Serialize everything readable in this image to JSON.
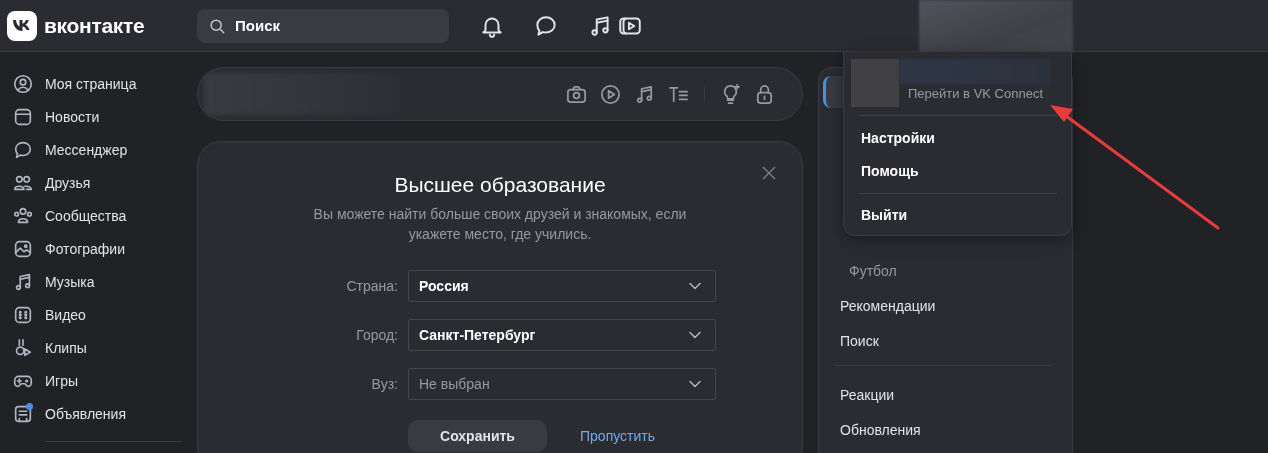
{
  "header": {
    "logo": "вконтакте",
    "search": {
      "placeholder": "Поиск"
    }
  },
  "sidebar": {
    "items": [
      {
        "label": "Моя страница",
        "dot": false
      },
      {
        "label": "Новости",
        "dot": false
      },
      {
        "label": "Мессенджер",
        "dot": false
      },
      {
        "label": "Друзья",
        "dot": false
      },
      {
        "label": "Сообщества",
        "dot": false
      },
      {
        "label": "Фотографии",
        "dot": false
      },
      {
        "label": "Музыка",
        "dot": false
      },
      {
        "label": "Видео",
        "dot": false
      },
      {
        "label": "Клипы",
        "dot": false
      },
      {
        "label": "Игры",
        "dot": false
      },
      {
        "label": "Объявления",
        "dot": true
      }
    ]
  },
  "education_card": {
    "title": "Высшее образование",
    "text": "Вы можете найти больше своих друзей и знакомых, если укажете место, где учились.",
    "fields": [
      {
        "label": "Страна:",
        "value": "Россия"
      },
      {
        "label": "Город:",
        "value": "Санкт-Петербург"
      },
      {
        "label": "Вуз:",
        "placeholder": "Не выбран"
      }
    ],
    "save_button": "Сохранить",
    "skip_link": "Пропустить"
  },
  "right_nav": {
    "items": [
      {
        "label": "Футбол",
        "kind": "subitem"
      },
      {
        "label": "Рекомендации",
        "kind": "item"
      },
      {
        "label": "Поиск",
        "kind": "item"
      },
      {
        "kind": "divider"
      },
      {
        "label": "Реакции",
        "kind": "item"
      },
      {
        "label": "Обновления",
        "kind": "item"
      }
    ]
  },
  "account_menu": {
    "link": "Перейти в VK Connect",
    "items": [
      {
        "label": "Настройки",
        "separated": false
      },
      {
        "label": "Помощь",
        "separated": false
      },
      {
        "label": "Выйти",
        "separated": true
      }
    ]
  }
}
